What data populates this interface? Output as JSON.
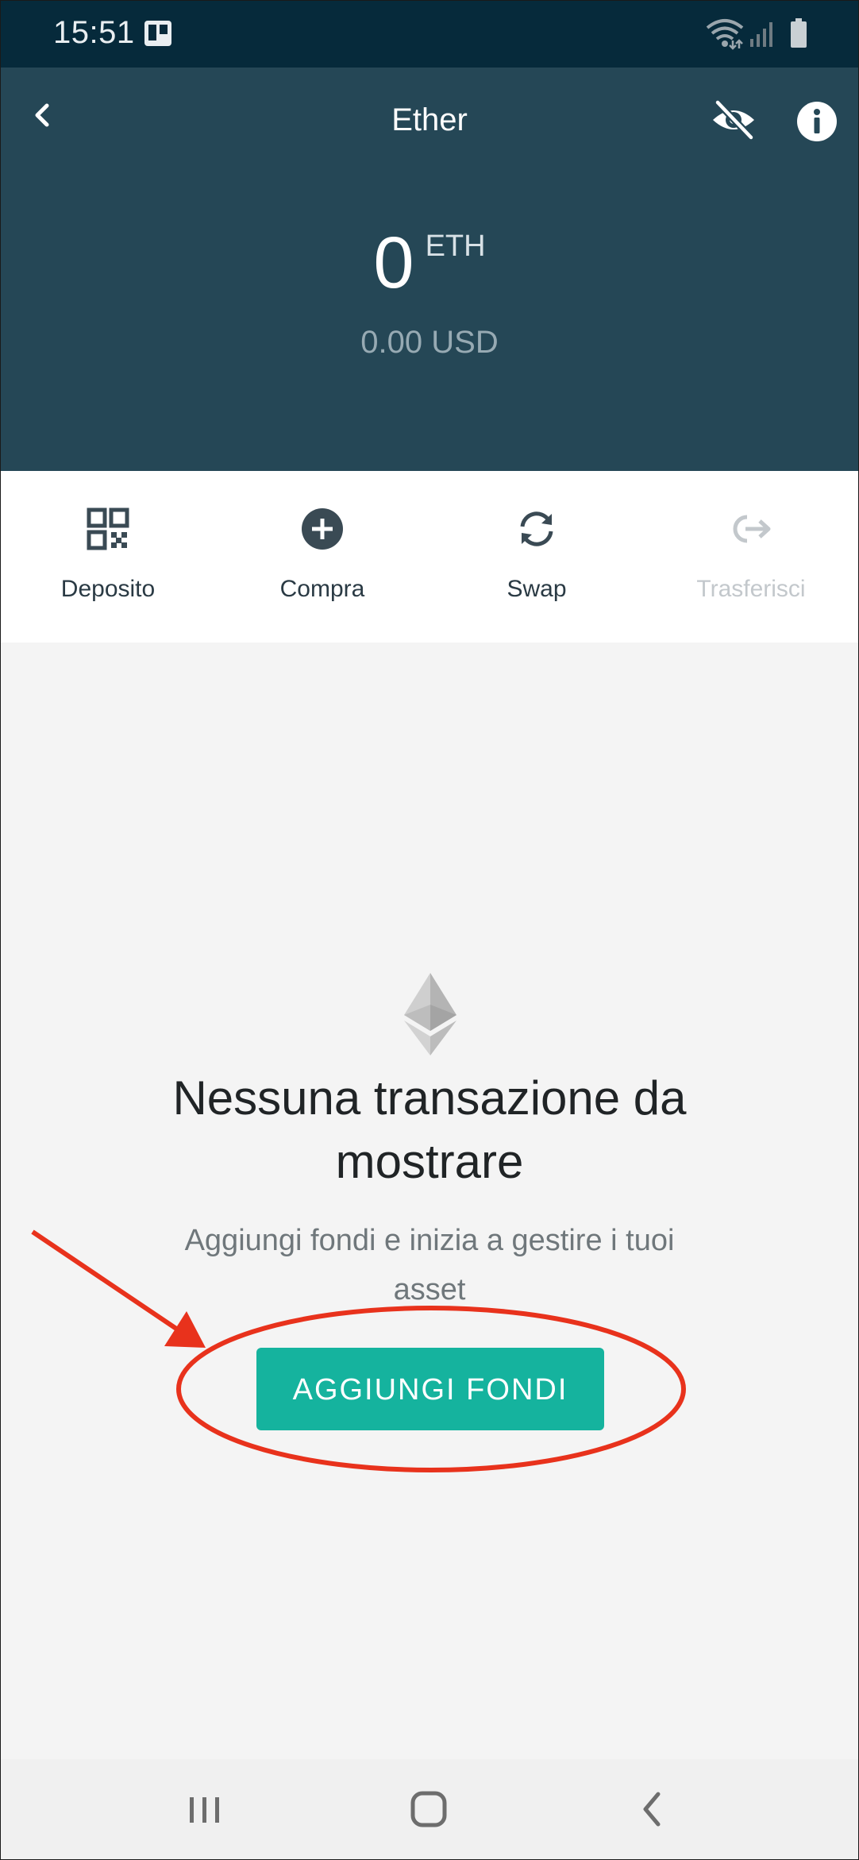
{
  "status_bar": {
    "time": "15:51",
    "icons": [
      "board-app-icon",
      "wifi-icon",
      "signal-icon",
      "battery-icon"
    ]
  },
  "header": {
    "title": "Ether",
    "back_icon": "chevron-left-icon",
    "hide_icon": "eye-slash-icon",
    "info_icon": "info-icon",
    "background_color": "#254756"
  },
  "balance": {
    "amount": "0",
    "unit": "ETH",
    "fiat": "0.00 USD"
  },
  "actions": [
    {
      "label": "Deposito",
      "icon": "qr-code-icon",
      "enabled": true
    },
    {
      "label": "Compra",
      "icon": "plus-circle-icon",
      "enabled": true
    },
    {
      "label": "Swap",
      "icon": "swap-icon",
      "enabled": true
    },
    {
      "label": "Trasferisci",
      "icon": "send-arrow-icon",
      "enabled": false
    }
  ],
  "empty_state": {
    "icon": "ethereum-logo-icon",
    "title": "Nessuna transazione da mostrare",
    "subtitle": "Aggiungi fondi e inizia a gestire i tuoi asset",
    "button_label": "AGGIUNGI FONDI"
  },
  "colors": {
    "accent": "#15b39e",
    "annotation": "#e8321c",
    "status_bar": "#062a3b"
  },
  "nav_bar": {
    "icons": [
      "recent-apps-icon",
      "home-icon",
      "back-icon"
    ]
  }
}
